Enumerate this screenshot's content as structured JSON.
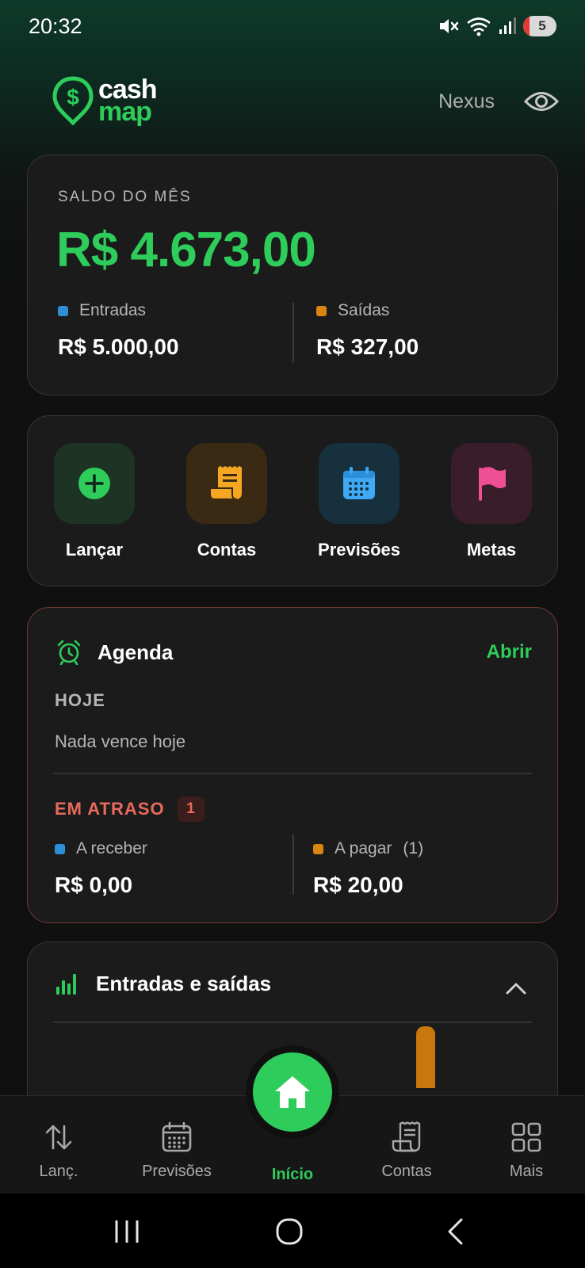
{
  "status_bar": {
    "time": "20:32",
    "battery_level": "5"
  },
  "header": {
    "logo_cash": "cash",
    "logo_map": "map",
    "user_name": "Nexus"
  },
  "balance": {
    "label": "SALDO DO MÊS",
    "value": "R$ 4.673,00",
    "income_label": "Entradas",
    "income_value": "R$ 5.000,00",
    "expense_label": "Saídas",
    "expense_value": "R$ 327,00"
  },
  "actions": [
    {
      "label": "Lançar",
      "icon": "plus-circle-icon"
    },
    {
      "label": "Contas",
      "icon": "receipt-icon"
    },
    {
      "label": "Previsões",
      "icon": "calendar-icon"
    },
    {
      "label": "Metas",
      "icon": "flag-icon"
    }
  ],
  "agenda": {
    "title": "Agenda",
    "open_label": "Abrir",
    "today_label": "HOJE",
    "today_empty": "Nada vence hoje",
    "overdue_label": "EM ATRASO",
    "overdue_count": "1",
    "receivable_label": "A receber",
    "receivable_value": "R$ 0,00",
    "payable_label": "A pagar",
    "payable_count": "(1)",
    "payable_value": "R$ 20,00"
  },
  "chart": {
    "title": "Entradas e saídas"
  },
  "chart_data": {
    "type": "bar",
    "title": "Entradas e saídas",
    "series": [
      {
        "name": "Saídas",
        "color": "#c8770e",
        "values": [
          327
        ]
      }
    ],
    "note_visible": "only top of one orange bar visible; remainder scrolled out of view"
  },
  "bottom_nav": {
    "items": [
      {
        "label": "Lanç.",
        "icon": "arrows-up-down-icon"
      },
      {
        "label": "Previsões",
        "icon": "calendar-icon"
      },
      {
        "label": "Início",
        "icon": "home-icon"
      },
      {
        "label": "Contas",
        "icon": "receipt-icon"
      },
      {
        "label": "Mais",
        "icon": "grid-icon"
      }
    ]
  },
  "colors": {
    "accent_green": "#2ecc5a",
    "income_blue": "#2e8fd6",
    "expense_orange": "#d98512",
    "overdue_red": "#e96a5c",
    "card_bg": "#1b1b1b"
  }
}
